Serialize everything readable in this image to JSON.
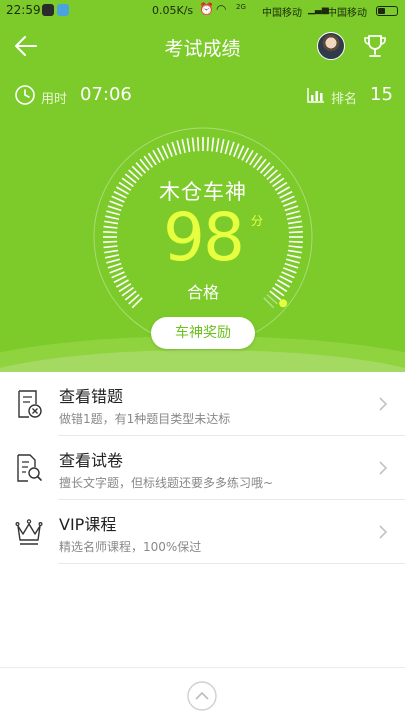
{
  "status_bar": {
    "time": "22:59",
    "net_speed": "0.05K/s",
    "carrier1": "中国移动",
    "carrier2": "中国移动",
    "signal_label": "2G"
  },
  "nav": {
    "title": "考试成绩"
  },
  "info": {
    "time_label": "用时",
    "time_value": "07:06",
    "rank_label": "排名",
    "rank_value": "15"
  },
  "result": {
    "rank_title": "木仓车神",
    "score": "98",
    "score_unit": "分",
    "status": "合格",
    "progress_fraction": 0.98,
    "reward_button": "车神奖励"
  },
  "menu": [
    {
      "title": "查看错题",
      "subtitle": "做错1题，有1种题目类型未达标",
      "icon": "wrong-questions-icon"
    },
    {
      "title": "查看试卷",
      "subtitle": "擅长文字题，但标线题还要多多练习哦~",
      "icon": "exam-paper-search-icon"
    },
    {
      "title": "VIP课程",
      "subtitle": "精选名师课程，100%保过",
      "icon": "crown-icon"
    }
  ],
  "colors": {
    "header_green": "#7ccb2a",
    "score_yellow": "#e6ff3f",
    "reward_text": "#6cbf1e"
  }
}
